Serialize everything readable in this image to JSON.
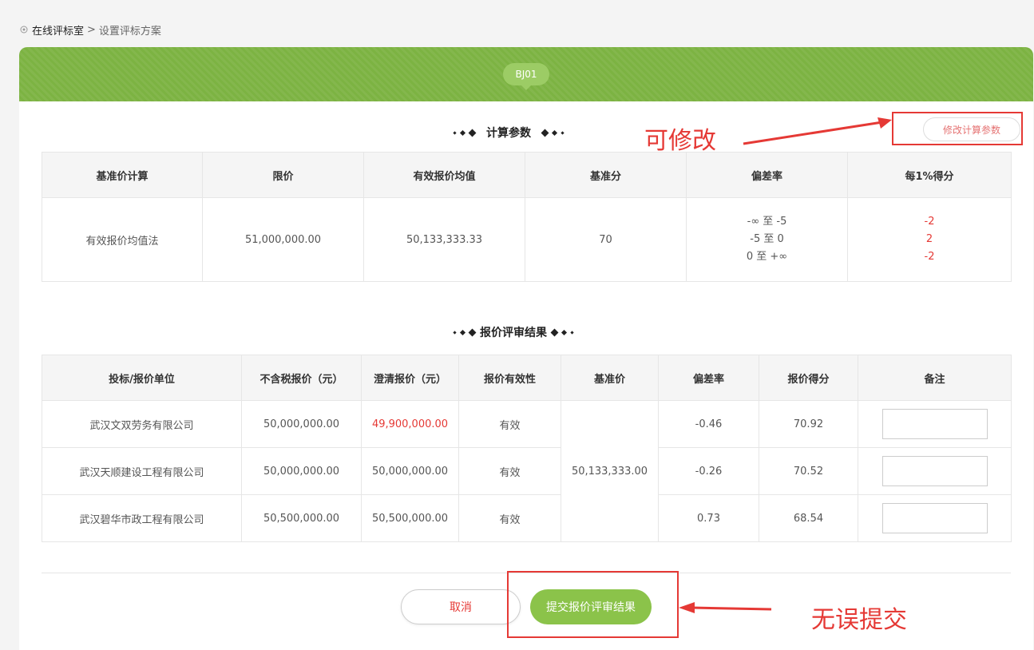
{
  "breadcrumb": {
    "home": "在线评标室",
    "separator": ">",
    "current": "设置评标方案"
  },
  "tag": "BJ01",
  "calc_section": {
    "title": "计算参数",
    "edit_button": "修改计算参数",
    "headers": [
      "基准价计算",
      "限价",
      "有效报价均值",
      "基准分",
      "偏差率",
      "每1%得分"
    ],
    "row": {
      "method": "有效报价均值法",
      "limit_price": "51,000,000.00",
      "avg_price": "50,133,333.33",
      "base_score": "70",
      "ranges": [
        "-∞ 至 -5",
        "-5 至 0",
        "0 至 +∞"
      ],
      "scores": [
        "-2",
        "2",
        "-2"
      ]
    }
  },
  "result_section": {
    "title": "报价评审结果",
    "headers": [
      "投标/报价单位",
      "不含税报价（元）",
      "澄清报价（元）",
      "报价有效性",
      "基准价",
      "偏差率",
      "报价得分",
      "备注"
    ],
    "base_price": "50,133,333.00",
    "rows": [
      {
        "company": "武汉文双劳务有限公司",
        "price": "50,000,000.00",
        "clarified": "49,900,000.00",
        "validity": "有效",
        "deviation": "-0.46",
        "score": "70.92",
        "remark": ""
      },
      {
        "company": "武汉天顺建设工程有限公司",
        "price": "50,000,000.00",
        "clarified": "50,000,000.00",
        "validity": "有效",
        "deviation": "-0.26",
        "score": "70.52",
        "remark": ""
      },
      {
        "company": "武汉碧华市政工程有限公司",
        "price": "50,500,000.00",
        "clarified": "50,500,000.00",
        "validity": "有效",
        "deviation": "0.73",
        "score": "68.54",
        "remark": ""
      }
    ]
  },
  "buttons": {
    "cancel": "取消",
    "submit": "提交报价评审结果"
  },
  "annotations": {
    "modify": "可修改",
    "submit": "无误提交"
  },
  "colors": {
    "header_green": "#7cb342",
    "accent_red": "#e53935",
    "button_green": "#8bc34a"
  }
}
